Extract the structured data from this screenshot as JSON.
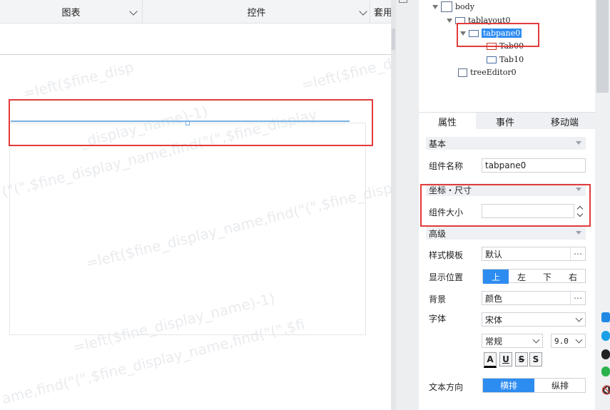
{
  "toolbar": {
    "chart_label": "图表",
    "widget_label": "控件",
    "apply_label": "套用"
  },
  "canvas": {
    "watermark_texts": [
      "=left($fine_disp",
      "=left($fine_d",
      "_display_name)-1)",
      "(\"(\",$fine_display_name,find(\"(\",$fine_display",
      "=left($fine_display_name,find(\"(\",$fine_display_name)-1)",
      "=left($fine_display_name)-1)",
      "ame,find(\"(\",$fine_display_name,find(\"(\",$fi"
    ]
  },
  "tree": {
    "nodes": [
      "body",
      "tablayout0",
      "tabpane0",
      "Tab00",
      "Tab10",
      "treeEditor0"
    ]
  },
  "tabs": [
    "属性",
    "事件",
    "移动端"
  ],
  "sections": {
    "basic": "基本",
    "coords": "坐标・尺寸",
    "advanced": "高级"
  },
  "props": {
    "name_label": "组件名称",
    "name_value": "tabpane0",
    "size_label": "组件大小",
    "size_value": "",
    "template_label": "样式模板",
    "template_value": "默认",
    "position_label": "显示位置",
    "position_options": [
      "上",
      "左",
      "下",
      "右"
    ],
    "position_selected": "上",
    "background_label": "背景",
    "background_value": "颜色",
    "font_label": "字体",
    "font_family": "宋体",
    "font_style": "常规",
    "font_size": "9.0",
    "format_buttons": [
      "A",
      "U",
      "S",
      "S"
    ],
    "direction_label": "文本方向",
    "direction_options": [
      "横排",
      "纵排"
    ],
    "direction_selected": "横排"
  },
  "colors": {
    "accent": "#2d8cf0",
    "highlight_red": "#e23b3b",
    "selection_line": "#7ab1e6"
  }
}
